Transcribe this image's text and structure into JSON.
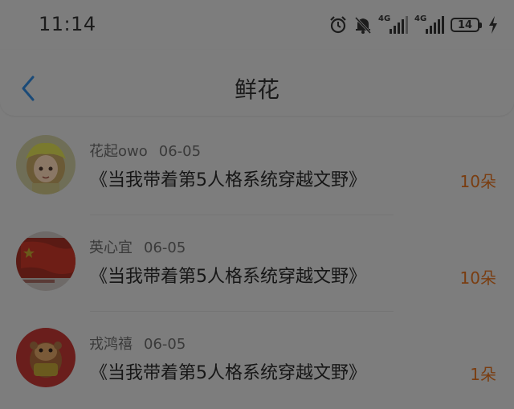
{
  "status_bar": {
    "time": "11:14",
    "icons": [
      "alarm-icon",
      "mute-bell-icon",
      "signal-4g-icon",
      "signal-4g-icon",
      "battery-icon",
      "charging-icon"
    ],
    "network_labels": [
      "4G",
      "4G"
    ],
    "battery_level": "14"
  },
  "nav": {
    "back_icon": "chevron-left-icon",
    "title": "鲜花"
  },
  "colors": {
    "background": "#7d7d7d",
    "back_icon": "#1a4a78",
    "amount_text": "#7a3d10"
  },
  "gifts": [
    {
      "user": "花起owo",
      "date": "06-05",
      "book": "《当我带着第5人格系统穿越文野》",
      "amount": "10朵"
    },
    {
      "user": "英心宜",
      "date": "06-05",
      "book": "《当我带着第5人格系统穿越文野》",
      "amount": "10朵"
    },
    {
      "user": "戎鸿禧",
      "date": "06-05",
      "book": "《当我带着第5人格系统穿越文野》",
      "amount": "1朵"
    }
  ]
}
